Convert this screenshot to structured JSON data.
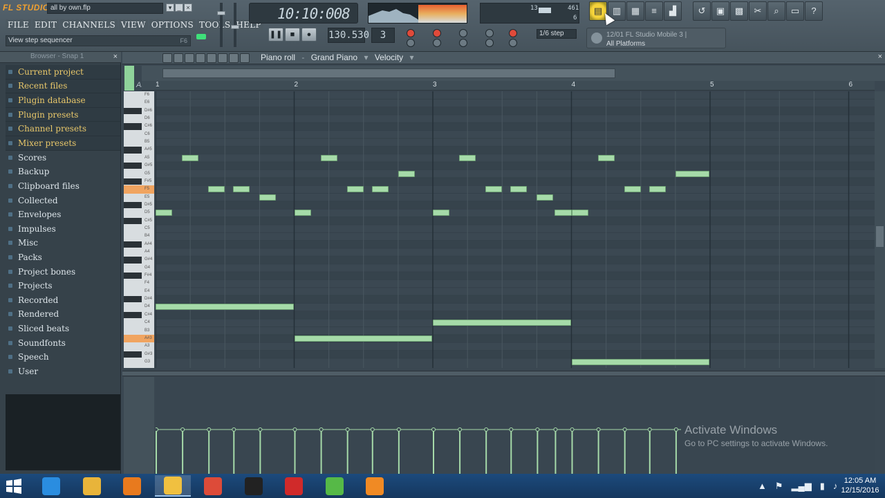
{
  "app": {
    "logo": "FL STUDIO",
    "project_file": "all by own.flp",
    "menus": [
      "FILE",
      "EDIT",
      "CHANNELS",
      "VIEW",
      "OPTIONS",
      "TOOLS",
      "HELP"
    ],
    "hint": "View step sequencer",
    "hint_key": "F6"
  },
  "transport": {
    "time": "10:10:008",
    "tempo": "130.530",
    "pattern": "3",
    "step": "1/6 step",
    "meters": {
      "cpu_top": "13",
      "mem_top": "461",
      "poly": "6"
    }
  },
  "news": {
    "line1": "12/01 FL Studio Mobile 3 |",
    "line2": "All Platforms"
  },
  "browser": {
    "title": "Browser - Snap 1",
    "close": "×",
    "items": [
      {
        "label": "Current project",
        "hi": true
      },
      {
        "label": "Recent files",
        "hi": true
      },
      {
        "label": "Plugin database",
        "hi": true
      },
      {
        "label": "Plugin presets",
        "hi": true
      },
      {
        "label": "Channel presets",
        "hi": true
      },
      {
        "label": "Mixer presets",
        "hi": true
      },
      {
        "label": "Scores",
        "hi": false
      },
      {
        "label": "Backup",
        "hi": false
      },
      {
        "label": "Clipboard files",
        "hi": false
      },
      {
        "label": "Collected",
        "hi": false
      },
      {
        "label": "Envelopes",
        "hi": false
      },
      {
        "label": "Impulses",
        "hi": false
      },
      {
        "label": "Misc",
        "hi": false
      },
      {
        "label": "Packs",
        "hi": false
      },
      {
        "label": "Project bones",
        "hi": false
      },
      {
        "label": "Projects",
        "hi": false
      },
      {
        "label": "Recorded",
        "hi": false
      },
      {
        "label": "Rendered",
        "hi": false
      },
      {
        "label": "Sliced beats",
        "hi": false
      },
      {
        "label": "Soundfonts",
        "hi": false
      },
      {
        "label": "Speech",
        "hi": false
      },
      {
        "label": "User",
        "hi": false
      }
    ]
  },
  "piano_roll": {
    "title": "Piano roll",
    "instrument": "Grand Piano",
    "lane": "Velocity",
    "abc": "Abc",
    "bars": [
      "1",
      "2",
      "3",
      "4",
      "5",
      "6"
    ],
    "key_labels": [
      "F6",
      "E6",
      "D#6",
      "D6",
      "C#6",
      "C6",
      "B5",
      "A#5",
      "A5",
      "G#5",
      "G5",
      "F#5",
      "F5",
      "E5",
      "D#5",
      "D5",
      "C#5",
      "C5",
      "B4",
      "A#4",
      "A4",
      "G#4",
      "G4",
      "F#4",
      "F4",
      "E4",
      "D#4",
      "D4",
      "C#4",
      "C4",
      "B3",
      "A#3",
      "A3",
      "G#3",
      "G3"
    ],
    "notes": [
      {
        "pitch": "D5",
        "start": 0.0,
        "len": 0.125
      },
      {
        "pitch": "A5",
        "start": 0.19,
        "len": 0.125
      },
      {
        "pitch": "F5",
        "start": 0.38,
        "len": 0.125
      },
      {
        "pitch": "F5",
        "start": 0.56,
        "len": 0.125
      },
      {
        "pitch": "E5",
        "start": 0.75,
        "len": 0.125
      },
      {
        "pitch": "D5",
        "start": 1.0,
        "len": 0.125
      },
      {
        "pitch": "A5",
        "start": 1.19,
        "len": 0.125
      },
      {
        "pitch": "F5",
        "start": 1.38,
        "len": 0.125
      },
      {
        "pitch": "F5",
        "start": 1.56,
        "len": 0.125
      },
      {
        "pitch": "G5",
        "start": 1.75,
        "len": 0.125
      },
      {
        "pitch": "D5",
        "start": 2.0,
        "len": 0.125
      },
      {
        "pitch": "A5",
        "start": 2.19,
        "len": 0.125
      },
      {
        "pitch": "F5",
        "start": 2.38,
        "len": 0.125
      },
      {
        "pitch": "F5",
        "start": 2.56,
        "len": 0.125
      },
      {
        "pitch": "E5",
        "start": 2.75,
        "len": 0.125
      },
      {
        "pitch": "D5",
        "start": 2.88,
        "len": 0.125
      },
      {
        "pitch": "D5",
        "start": 3.0,
        "len": 0.125
      },
      {
        "pitch": "A5",
        "start": 3.19,
        "len": 0.125
      },
      {
        "pitch": "F5",
        "start": 3.38,
        "len": 0.125
      },
      {
        "pitch": "F5",
        "start": 3.56,
        "len": 0.125
      },
      {
        "pitch": "G5",
        "start": 3.75,
        "len": 0.25
      },
      {
        "pitch": "D4",
        "start": 0.0,
        "len": 1.0
      },
      {
        "pitch": "A#3",
        "start": 1.0,
        "len": 1.0
      },
      {
        "pitch": "C4",
        "start": 2.0,
        "len": 1.0
      },
      {
        "pitch": "G3",
        "start": 3.0,
        "len": 1.0
      }
    ]
  },
  "watermark": {
    "title": "Activate Windows",
    "subtitle": "Go to PC settings to activate Windows."
  },
  "taskbar": {
    "apps": [
      {
        "name": "ie",
        "color": "#2a8de0",
        "active": false
      },
      {
        "name": "file-explorer",
        "color": "#e8b43a",
        "active": false
      },
      {
        "name": "avast",
        "color": "#e87a1e",
        "active": false
      },
      {
        "name": "fl-studio",
        "color": "#f0c040",
        "active": true
      },
      {
        "name": "chrome",
        "color": "#dd4b39",
        "active": false
      },
      {
        "name": "media-app",
        "color": "#222222",
        "active": false
      },
      {
        "name": "recorder",
        "color": "#d02a2a",
        "active": false
      },
      {
        "name": "utorrent",
        "color": "#56b947",
        "active": false
      },
      {
        "name": "orange-app",
        "color": "#f08a24",
        "active": false
      }
    ],
    "time": "12:05 AM",
    "date": "12/15/2016"
  }
}
